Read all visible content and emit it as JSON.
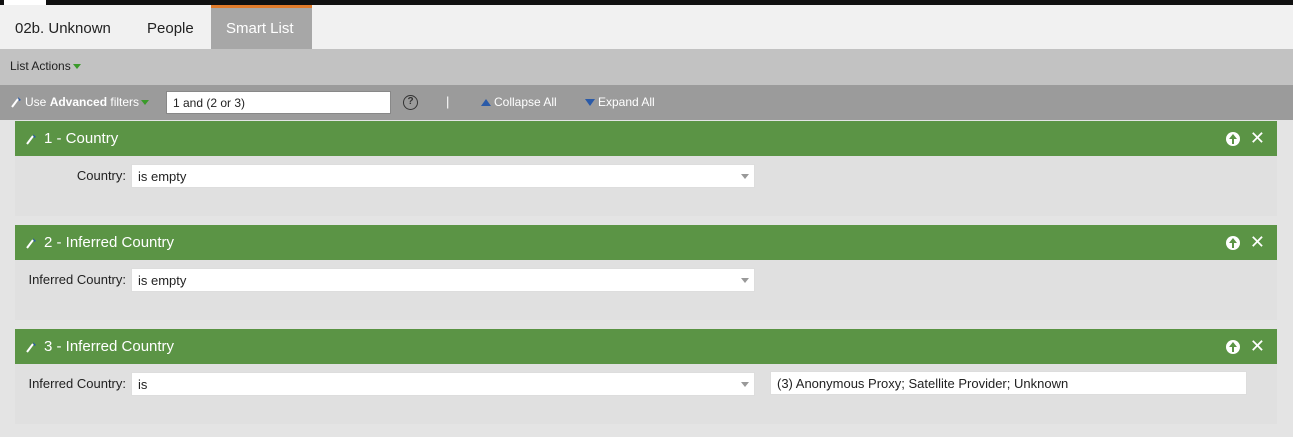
{
  "tabs": [
    {
      "label": "02b. Unknown"
    },
    {
      "label": "People"
    },
    {
      "label": "Smart List"
    }
  ],
  "list_actions": {
    "label": "List Actions"
  },
  "filter_bar": {
    "use_prefix": "Use ",
    "use_bold": "Advanced",
    "use_suffix": " filters",
    "logic_value": "1 and (2 or 3)",
    "help": "?",
    "separator": "|",
    "collapse_all": "Collapse All",
    "expand_all": "Expand All"
  },
  "filters": [
    {
      "title": "1 - Country",
      "field_label": "Country:",
      "operator": "is empty"
    },
    {
      "title": "2 - Inferred Country",
      "field_label": "Inferred Country:",
      "operator": "is empty"
    },
    {
      "title": "3 - Inferred Country",
      "field_label": "Inferred Country:",
      "operator": "is",
      "value": "(3) Anonymous Proxy; Satellite Provider; Unknown"
    }
  ],
  "colors": {
    "filter_header": "#5b9445",
    "active_tab_accent": "#e07b2b"
  }
}
